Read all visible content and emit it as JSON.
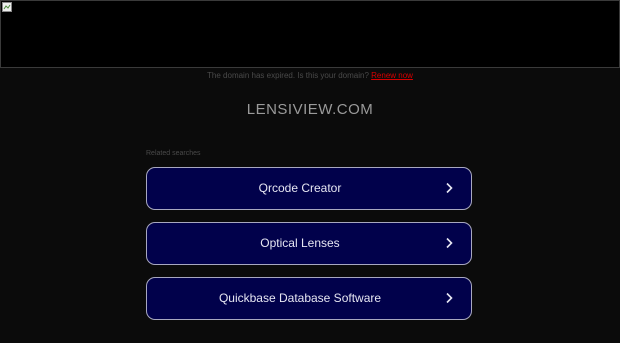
{
  "notice": {
    "text": "The domain has expired. Is this your domain?",
    "renew_label": "Renew now"
  },
  "domain_name": "LENSIVIEW.COM",
  "related": {
    "heading": "Related searches",
    "items": [
      {
        "label": "Qrcode Creator"
      },
      {
        "label": "Optical Lenses"
      },
      {
        "label": "Quickbase Database Software"
      }
    ]
  },
  "colors": {
    "background": "#0b0b0b",
    "button_bg": "#01014b",
    "button_border": "#a8a8c0",
    "renew_link": "#d60000"
  },
  "icons": {
    "banner": "broken-image-icon",
    "item_arrow": "chevron-right-icon"
  }
}
